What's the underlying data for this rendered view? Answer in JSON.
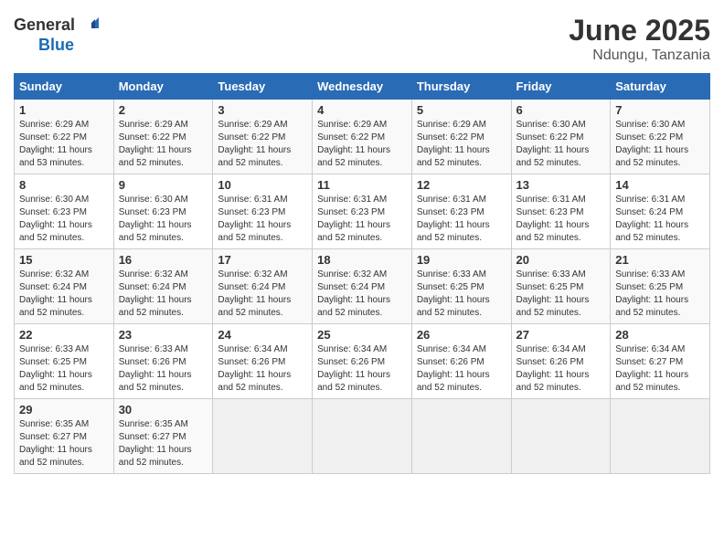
{
  "logo": {
    "text_general": "General",
    "text_blue": "Blue"
  },
  "title": "June 2025",
  "subtitle": "Ndungu, Tanzania",
  "days_of_week": [
    "Sunday",
    "Monday",
    "Tuesday",
    "Wednesday",
    "Thursday",
    "Friday",
    "Saturday"
  ],
  "weeks": [
    [
      {
        "day": "1",
        "sunrise": "Sunrise: 6:29 AM",
        "sunset": "Sunset: 6:22 PM",
        "daylight": "Daylight: 11 hours and 53 minutes."
      },
      {
        "day": "2",
        "sunrise": "Sunrise: 6:29 AM",
        "sunset": "Sunset: 6:22 PM",
        "daylight": "Daylight: 11 hours and 52 minutes."
      },
      {
        "day": "3",
        "sunrise": "Sunrise: 6:29 AM",
        "sunset": "Sunset: 6:22 PM",
        "daylight": "Daylight: 11 hours and 52 minutes."
      },
      {
        "day": "4",
        "sunrise": "Sunrise: 6:29 AM",
        "sunset": "Sunset: 6:22 PM",
        "daylight": "Daylight: 11 hours and 52 minutes."
      },
      {
        "day": "5",
        "sunrise": "Sunrise: 6:29 AM",
        "sunset": "Sunset: 6:22 PM",
        "daylight": "Daylight: 11 hours and 52 minutes."
      },
      {
        "day": "6",
        "sunrise": "Sunrise: 6:30 AM",
        "sunset": "Sunset: 6:22 PM",
        "daylight": "Daylight: 11 hours and 52 minutes."
      },
      {
        "day": "7",
        "sunrise": "Sunrise: 6:30 AM",
        "sunset": "Sunset: 6:22 PM",
        "daylight": "Daylight: 11 hours and 52 minutes."
      }
    ],
    [
      {
        "day": "8",
        "sunrise": "Sunrise: 6:30 AM",
        "sunset": "Sunset: 6:23 PM",
        "daylight": "Daylight: 11 hours and 52 minutes."
      },
      {
        "day": "9",
        "sunrise": "Sunrise: 6:30 AM",
        "sunset": "Sunset: 6:23 PM",
        "daylight": "Daylight: 11 hours and 52 minutes."
      },
      {
        "day": "10",
        "sunrise": "Sunrise: 6:31 AM",
        "sunset": "Sunset: 6:23 PM",
        "daylight": "Daylight: 11 hours and 52 minutes."
      },
      {
        "day": "11",
        "sunrise": "Sunrise: 6:31 AM",
        "sunset": "Sunset: 6:23 PM",
        "daylight": "Daylight: 11 hours and 52 minutes."
      },
      {
        "day": "12",
        "sunrise": "Sunrise: 6:31 AM",
        "sunset": "Sunset: 6:23 PM",
        "daylight": "Daylight: 11 hours and 52 minutes."
      },
      {
        "day": "13",
        "sunrise": "Sunrise: 6:31 AM",
        "sunset": "Sunset: 6:23 PM",
        "daylight": "Daylight: 11 hours and 52 minutes."
      },
      {
        "day": "14",
        "sunrise": "Sunrise: 6:31 AM",
        "sunset": "Sunset: 6:24 PM",
        "daylight": "Daylight: 11 hours and 52 minutes."
      }
    ],
    [
      {
        "day": "15",
        "sunrise": "Sunrise: 6:32 AM",
        "sunset": "Sunset: 6:24 PM",
        "daylight": "Daylight: 11 hours and 52 minutes."
      },
      {
        "day": "16",
        "sunrise": "Sunrise: 6:32 AM",
        "sunset": "Sunset: 6:24 PM",
        "daylight": "Daylight: 11 hours and 52 minutes."
      },
      {
        "day": "17",
        "sunrise": "Sunrise: 6:32 AM",
        "sunset": "Sunset: 6:24 PM",
        "daylight": "Daylight: 11 hours and 52 minutes."
      },
      {
        "day": "18",
        "sunrise": "Sunrise: 6:32 AM",
        "sunset": "Sunset: 6:24 PM",
        "daylight": "Daylight: 11 hours and 52 minutes."
      },
      {
        "day": "19",
        "sunrise": "Sunrise: 6:33 AM",
        "sunset": "Sunset: 6:25 PM",
        "daylight": "Daylight: 11 hours and 52 minutes."
      },
      {
        "day": "20",
        "sunrise": "Sunrise: 6:33 AM",
        "sunset": "Sunset: 6:25 PM",
        "daylight": "Daylight: 11 hours and 52 minutes."
      },
      {
        "day": "21",
        "sunrise": "Sunrise: 6:33 AM",
        "sunset": "Sunset: 6:25 PM",
        "daylight": "Daylight: 11 hours and 52 minutes."
      }
    ],
    [
      {
        "day": "22",
        "sunrise": "Sunrise: 6:33 AM",
        "sunset": "Sunset: 6:25 PM",
        "daylight": "Daylight: 11 hours and 52 minutes."
      },
      {
        "day": "23",
        "sunrise": "Sunrise: 6:33 AM",
        "sunset": "Sunset: 6:26 PM",
        "daylight": "Daylight: 11 hours and 52 minutes."
      },
      {
        "day": "24",
        "sunrise": "Sunrise: 6:34 AM",
        "sunset": "Sunset: 6:26 PM",
        "daylight": "Daylight: 11 hours and 52 minutes."
      },
      {
        "day": "25",
        "sunrise": "Sunrise: 6:34 AM",
        "sunset": "Sunset: 6:26 PM",
        "daylight": "Daylight: 11 hours and 52 minutes."
      },
      {
        "day": "26",
        "sunrise": "Sunrise: 6:34 AM",
        "sunset": "Sunset: 6:26 PM",
        "daylight": "Daylight: 11 hours and 52 minutes."
      },
      {
        "day": "27",
        "sunrise": "Sunrise: 6:34 AM",
        "sunset": "Sunset: 6:26 PM",
        "daylight": "Daylight: 11 hours and 52 minutes."
      },
      {
        "day": "28",
        "sunrise": "Sunrise: 6:34 AM",
        "sunset": "Sunset: 6:27 PM",
        "daylight": "Daylight: 11 hours and 52 minutes."
      }
    ],
    [
      {
        "day": "29",
        "sunrise": "Sunrise: 6:35 AM",
        "sunset": "Sunset: 6:27 PM",
        "daylight": "Daylight: 11 hours and 52 minutes."
      },
      {
        "day": "30",
        "sunrise": "Sunrise: 6:35 AM",
        "sunset": "Sunset: 6:27 PM",
        "daylight": "Daylight: 11 hours and 52 minutes."
      },
      {
        "day": "",
        "sunrise": "",
        "sunset": "",
        "daylight": ""
      },
      {
        "day": "",
        "sunrise": "",
        "sunset": "",
        "daylight": ""
      },
      {
        "day": "",
        "sunrise": "",
        "sunset": "",
        "daylight": ""
      },
      {
        "day": "",
        "sunrise": "",
        "sunset": "",
        "daylight": ""
      },
      {
        "day": "",
        "sunrise": "",
        "sunset": "",
        "daylight": ""
      }
    ]
  ]
}
